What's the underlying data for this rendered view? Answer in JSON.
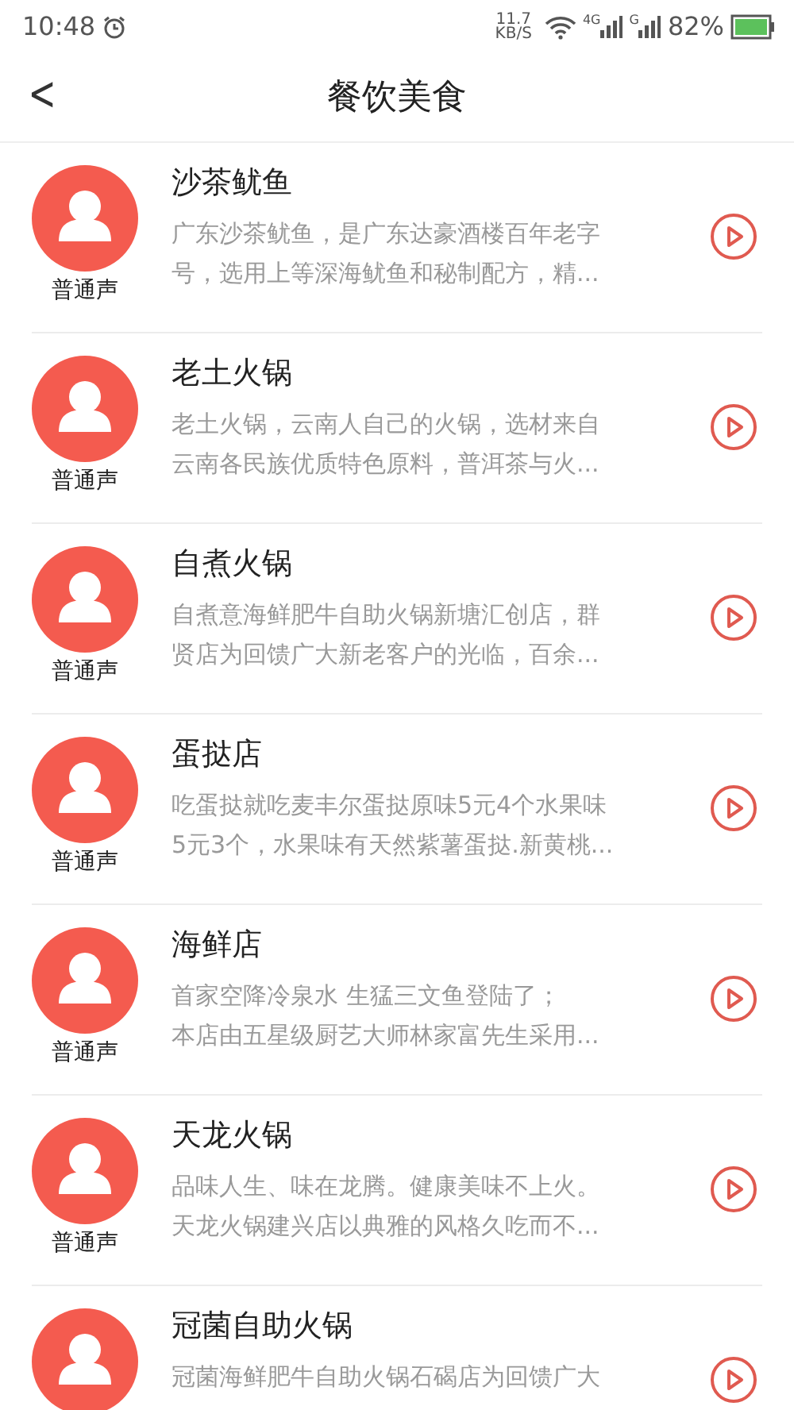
{
  "status_bar": {
    "time": "10:48",
    "speed": "11.7",
    "speed_unit": "KB/S",
    "network_1": "4G",
    "network_2": "G",
    "battery": "82%"
  },
  "header": {
    "back": "<",
    "title": "餐饮美食"
  },
  "items": [
    {
      "title": "沙茶鱿鱼",
      "lines": [
        "广东沙茶鱿鱼，是广东达豪酒楼百年老字",
        "号，选用上等深海鱿鱼和秘制配方，精..."
      ],
      "voice": "普通声"
    },
    {
      "title": "老土火锅",
      "lines": [
        "老土火锅，云南人自己的火锅，选材来自",
        "云南各民族优质特色原料，普洱茶与火..."
      ],
      "voice": "普通声"
    },
    {
      "title": "自煮火锅",
      "lines": [
        "自煮意海鲜肥牛自助火锅新塘汇创店，群",
        "贤店为回馈广大新老客户的光临，百余..."
      ],
      "voice": "普通声"
    },
    {
      "title": "蛋挞店",
      "lines": [
        "吃蛋挞就吃麦丰尔蛋挞原味5元4个水果味",
        "5元3个，水果味有天然紫薯蛋挞.新黄桃..."
      ],
      "voice": "普通声"
    },
    {
      "title": "海鲜店",
      "lines": [
        "首家空降冷泉水 生猛三文鱼登陆了；",
        "本店由五星级厨艺大师林家富先生采用..."
      ],
      "voice": "普通声"
    },
    {
      "title": "天龙火锅",
      "lines": [
        "品味人生、味在龙腾。健康美味不上火。",
        "天龙火锅建兴店以典雅的风格久吃而不..."
      ],
      "voice": "普通声"
    },
    {
      "title": "冠菌自助火锅",
      "lines": [
        "冠菌海鲜肥牛自助火锅石碣店为回馈广大"
      ]
    }
  ]
}
